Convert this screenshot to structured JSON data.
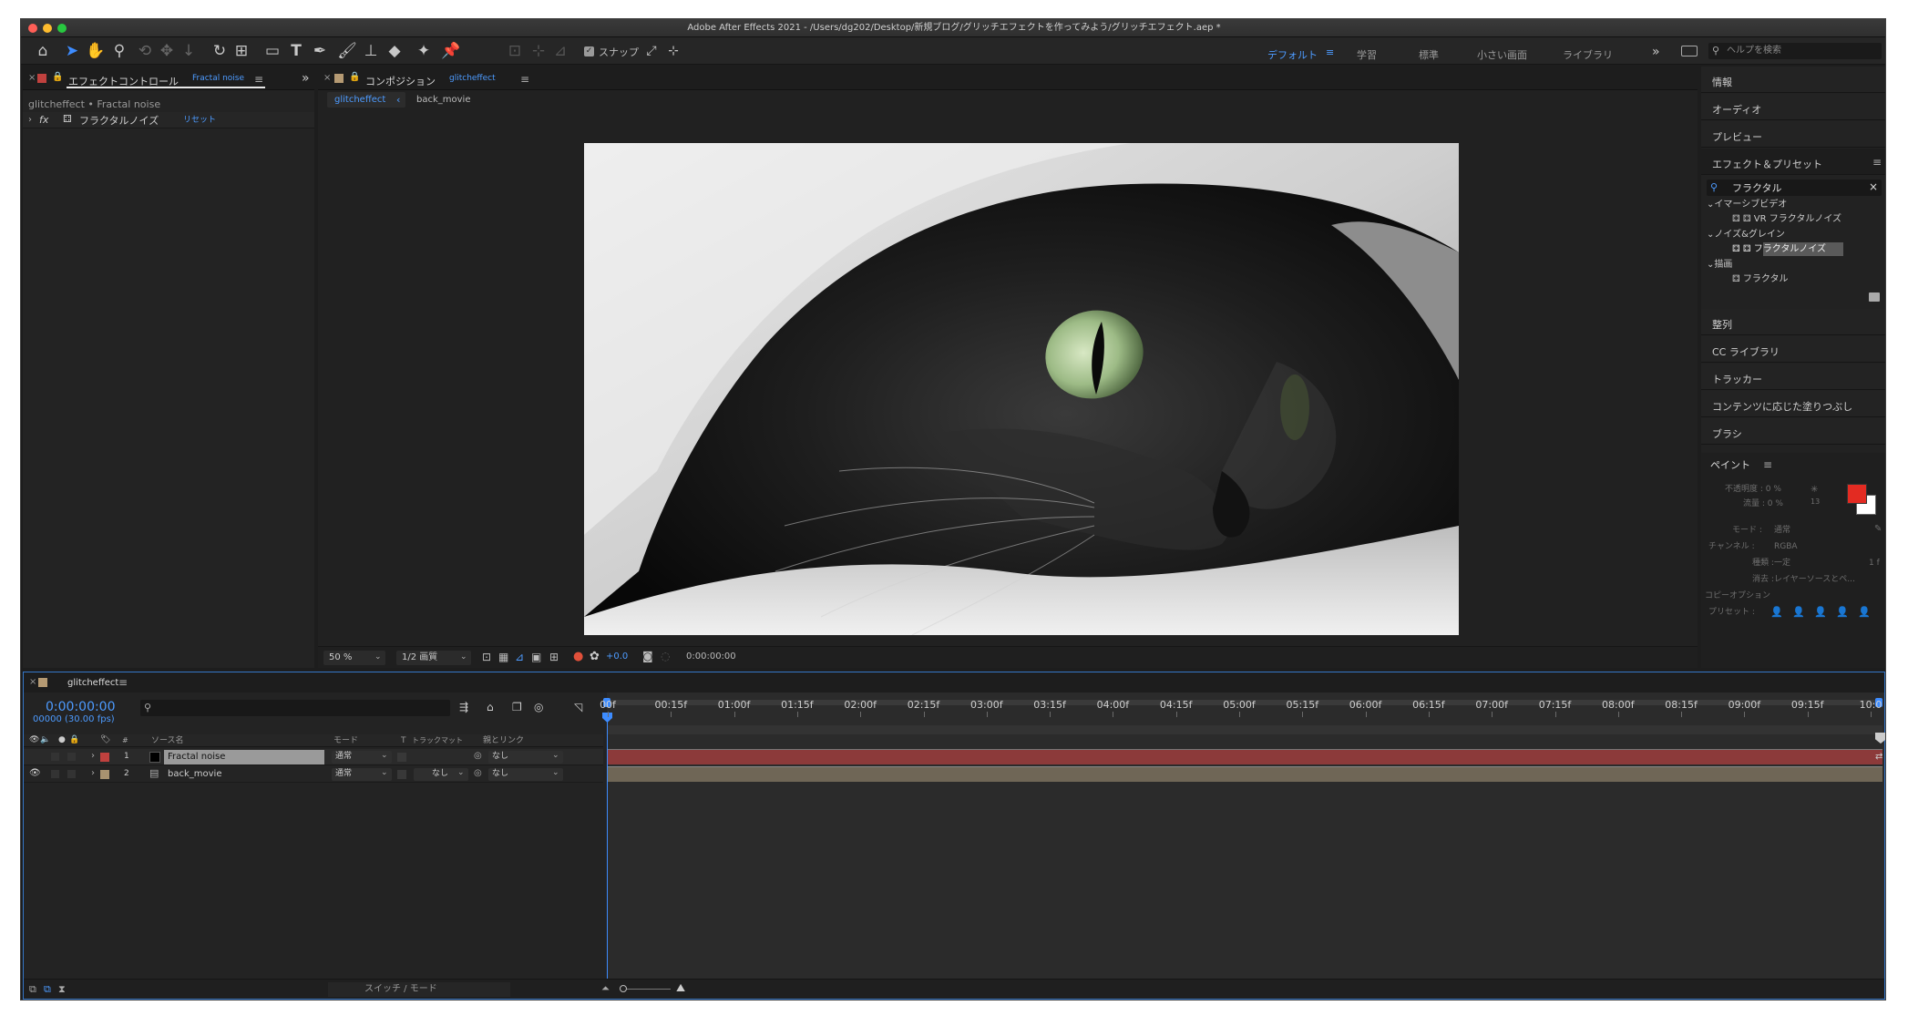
{
  "window": {
    "title": "Adobe After Effects 2021 - /Users/dg202/Desktop/新規ブログ/グリッチエフェクトを作ってみよう/グリッチエフェクト.aep *"
  },
  "toolbar": {
    "snap_label": "スナップ",
    "workspaces": [
      "デフォルト",
      "学習",
      "標準",
      "小さい画面",
      "ライブラリ"
    ],
    "help_placeholder": "ヘルプを検索"
  },
  "effect_controls": {
    "tab_label": "エフェクトコントロール",
    "tab_layer": "Fractal noise",
    "breadcrumb": "glitcheffect • Fractal noise",
    "effect_fx": "fx",
    "effect_name": "フラクタルノイズ",
    "reset_label": "リセット"
  },
  "composition": {
    "tab_label": "コンポジション",
    "tab_comp": "glitcheffect",
    "nav": [
      "glitcheffect",
      "back_movie"
    ],
    "zoom": "50 %",
    "quality": "1/2 画質",
    "exposure": "+0.0",
    "timecode": "0:00:00:00"
  },
  "right_panel": {
    "items_top": [
      "情報",
      "オーディオ",
      "プレビュー"
    ],
    "effects_title": "エフェクト＆プリセット",
    "search_value": "フラクタル",
    "tree": [
      {
        "cat": "イマーシブビデオ",
        "items": [
          "VR フラクタルノイズ"
        ]
      },
      {
        "cat": "ノイズ&グレイン",
        "items": [
          "フラクタルノイズ"
        ]
      },
      {
        "cat": "描画",
        "items": [
          "フラクタル"
        ]
      }
    ],
    "items_bottom": [
      "整列",
      "CC ライブラリ",
      "トラッカー",
      "コンテンツに応じた塗りつぶし",
      "ブラシ"
    ],
    "paint": {
      "title": "ペイント",
      "opacity_label": "不透明度 : 0 %",
      "flow_label": "流量 : 0 %",
      "brush_size": "13",
      "mode_label": "モード :",
      "mode_value": "通常",
      "channel_label": "チャンネル :",
      "channel_value": "RGBA",
      "duration_label": "種類 :",
      "duration_value": "一定",
      "duration_frames": "1 f",
      "erase_label": "消去 :",
      "erase_value": "レイヤーソースとペ...",
      "clone_label": "コピーオプション",
      "preset_label": "プリセット :",
      "fg_color": "#e32b22",
      "bg_color": "#ffffff"
    }
  },
  "timeline": {
    "tab_label": "glitcheffect",
    "timecode": "0:00:00:00",
    "frames_fps": "00000 (30.00 fps)",
    "search_placeholder": "",
    "columns": {
      "source": "ソース名",
      "mode": "モード",
      "t": "T",
      "trackmatte": "トラックマット",
      "parent": "親とリンク"
    },
    "layers": [
      {
        "num": "1",
        "name": "Fractal noise",
        "mode": "通常",
        "trackmatte": "",
        "parent": "なし",
        "label_color": "#c0413e",
        "bar_color": "#8c3a3a"
      },
      {
        "num": "2",
        "name": "back_movie",
        "mode": "通常",
        "trackmatte": "なし",
        "parent": "なし",
        "label_color": "#a89270",
        "bar_color": "#6f6656"
      }
    ],
    "ruler": [
      "00f",
      "00:15f",
      "01:00f",
      "01:15f",
      "02:00f",
      "02:15f",
      "03:00f",
      "03:15f",
      "04:00f",
      "04:15f",
      "05:00f",
      "05:15f",
      "06:00f",
      "06:15f",
      "07:00f",
      "07:15f",
      "08:00f",
      "08:15f",
      "09:00f",
      "09:15f",
      "10:0"
    ],
    "footer_label": "スイッチ / モード"
  },
  "icons": [
    "home-icon",
    "selection-arrow-icon",
    "hand-icon",
    "zoom-icon",
    "rotate-icon",
    "rectangle-icon",
    "type-icon",
    "pen-icon",
    "brush-icon",
    "stamp-icon",
    "eraser-icon",
    "roto-brush-icon",
    "pin-icon",
    "search-icon",
    "camera-icon",
    "eye-icon",
    "lock-icon",
    "chevron-right-icon"
  ]
}
